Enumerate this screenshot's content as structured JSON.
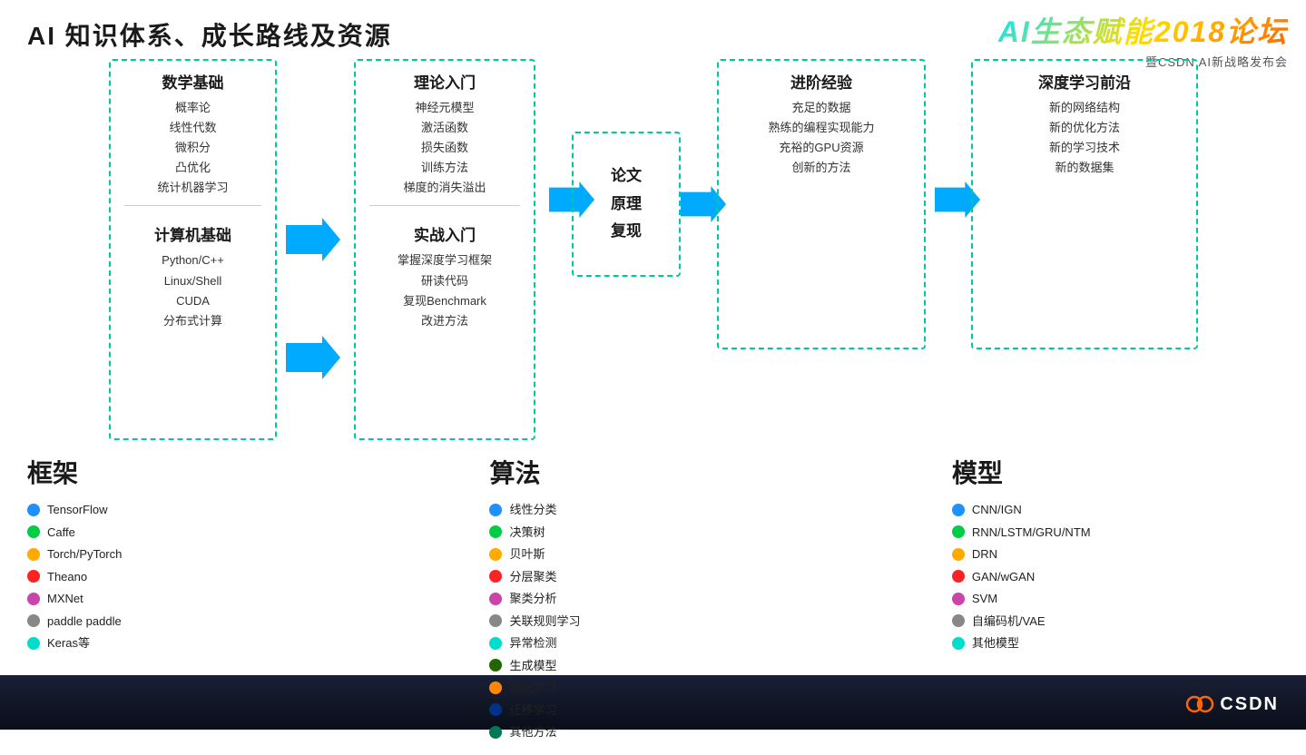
{
  "page": {
    "title": "AI 知识体系、成长路线及资源",
    "logo_main": "AI生态赋能2018论坛",
    "logo_sub": "暨CSDN AI新战略发布会"
  },
  "boxes": {
    "box1": {
      "section1_title": "数学基础",
      "section1_items": [
        "概率论",
        "线性代数",
        "微积分",
        "凸优化",
        "统计机器学习"
      ],
      "section2_title": "计算机基础",
      "section2_items": [
        "Python/C++",
        "Linux/Shell",
        "CUDA",
        "分布式计算"
      ]
    },
    "box2": {
      "section1_title": "理论入门",
      "section1_items": [
        "神经元模型",
        "激活函数",
        "损失函数",
        "训练方法",
        "梯度的消失溢出"
      ],
      "section2_title": "实战入门",
      "section2_items": [
        "掌握深度学习框架",
        "研读代码",
        "复现Benchmark",
        "改进方法"
      ]
    },
    "box3": {
      "lines": [
        "论文",
        "原理",
        "复现"
      ]
    },
    "box4": {
      "title": "进阶经验",
      "items": [
        "充足的数据",
        "熟练的编程实现能力",
        "充裕的GPU资源",
        "创新的方法"
      ]
    },
    "box5": {
      "title": "深度学习前沿",
      "items": [
        "新的网络结构",
        "新的优化方法",
        "新的学习技术",
        "新的数据集"
      ]
    }
  },
  "frameworks": {
    "title": "框架",
    "items": [
      {
        "color": "#1e90ff",
        "label": "TensorFlow"
      },
      {
        "color": "#00cc44",
        "label": "Caffe"
      },
      {
        "color": "#ffaa00",
        "label": "Torch/PyTorch"
      },
      {
        "color": "#ff2222",
        "label": "Theano"
      },
      {
        "color": "#cc44aa",
        "label": "MXNet"
      },
      {
        "color": "#888888",
        "label": "paddle paddle"
      },
      {
        "color": "#00ddcc",
        "label": "Keras等"
      }
    ]
  },
  "algorithms": {
    "title": "算法",
    "items": [
      {
        "color": "#1e90ff",
        "label": "线性分类"
      },
      {
        "color": "#00cc44",
        "label": "决策树"
      },
      {
        "color": "#ffaa00",
        "label": "贝叶斯"
      },
      {
        "color": "#ff2222",
        "label": "分层聚类"
      },
      {
        "color": "#cc44aa",
        "label": "聚类分析"
      },
      {
        "color": "#888888",
        "label": "关联规则学习"
      },
      {
        "color": "#00ddcc",
        "label": "异常检测"
      },
      {
        "color": "#226600",
        "label": "生成模型"
      },
      {
        "color": "#ff8800",
        "label": "强化学习"
      },
      {
        "color": "#003388",
        "label": "迁移学习"
      },
      {
        "color": "#007755",
        "label": "其他方法"
      }
    ]
  },
  "models": {
    "title": "模型",
    "items": [
      {
        "color": "#1e90ff",
        "label": "CNN/IGN"
      },
      {
        "color": "#00cc44",
        "label": "RNN/LSTM/GRU/NTM"
      },
      {
        "color": "#ffaa00",
        "label": "DRN"
      },
      {
        "color": "#ff2222",
        "label": "GAN/wGAN"
      },
      {
        "color": "#cc44aa",
        "label": "SVM"
      },
      {
        "color": "#888888",
        "label": "自编码机/VAE"
      },
      {
        "color": "#00ddcc",
        "label": "其他模型"
      }
    ]
  },
  "csdn": {
    "text": "CSDN"
  }
}
